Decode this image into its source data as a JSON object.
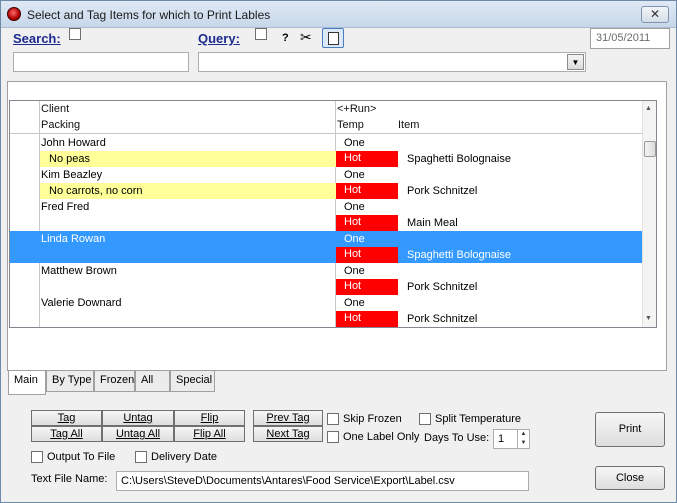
{
  "window": {
    "title": "Select and Tag Items for which to Print  Lables",
    "close_glyph": "✕"
  },
  "toolbar": {
    "search_label": "Search:",
    "query_label": "Query:",
    "help_glyph": "?",
    "scissors_icon": "scissors-icon",
    "tag_icon": "tag-document-icon",
    "date": "31/05/2011",
    "search_value": "",
    "query_value": ""
  },
  "grid": {
    "headers": {
      "client": "Client",
      "run": "<+Run>",
      "packing": "Packing",
      "temp": "Temp",
      "item": "Item"
    },
    "rows": [
      {
        "client": "John Howard",
        "run": "One",
        "packing": "No peas",
        "temp": "Hot",
        "item": "Spaghetti Bolognaise",
        "packing_highlight": true,
        "selected": false
      },
      {
        "client": "Kim Beazley",
        "run": "One",
        "packing": "No carrots, no corn",
        "temp": "Hot",
        "item": "Pork Schnitzel",
        "packing_highlight": true,
        "selected": false
      },
      {
        "client": "Fred Fred",
        "run": "One",
        "packing": "",
        "temp": "Hot",
        "item": "Main Meal",
        "packing_highlight": false,
        "selected": false
      },
      {
        "client": "Linda Rowan",
        "run": "One",
        "packing": "",
        "temp": "Hot",
        "item": "Spaghetti Bolognaise",
        "packing_highlight": false,
        "selected": true
      },
      {
        "client": "Matthew Brown",
        "run": "One",
        "packing": "",
        "temp": "Hot",
        "item": "Pork Schnitzel",
        "packing_highlight": false,
        "selected": false
      },
      {
        "client": "Valerie Downard",
        "run": "One",
        "packing": "",
        "temp": "Hot",
        "item": "Pork Schnitzel",
        "packing_highlight": false,
        "selected": false
      }
    ]
  },
  "tabs": [
    "Main",
    "By Type",
    "Frozen",
    "All",
    "Special"
  ],
  "buttons": {
    "tag": "Tag",
    "tag_all": "Tag All",
    "untag": "Untag",
    "untag_all": "Untag All",
    "flip": "Flip",
    "flip_all": "Flip All",
    "prev_tag": "Prev Tag",
    "next_tag": "Next Tag",
    "print": "Print",
    "close": "Close"
  },
  "options": {
    "skip_frozen": "Skip Frozen",
    "split_temperature": "Split Temperature",
    "one_label_only": "One Label Only",
    "days_to_use_label": "Days To Use:",
    "days_to_use_value": "1",
    "output_to_file": "Output To File",
    "delivery_date": "Delivery Date",
    "text_file_label": "Text File Name:",
    "text_file_value": "C:\\Users\\SteveD\\Documents\\Antares\\Food Service\\Export\\Label.csv"
  },
  "colors": {
    "selection": "#3399ff",
    "hot": "#ff0000",
    "packing_highlight": "#ffff99"
  }
}
